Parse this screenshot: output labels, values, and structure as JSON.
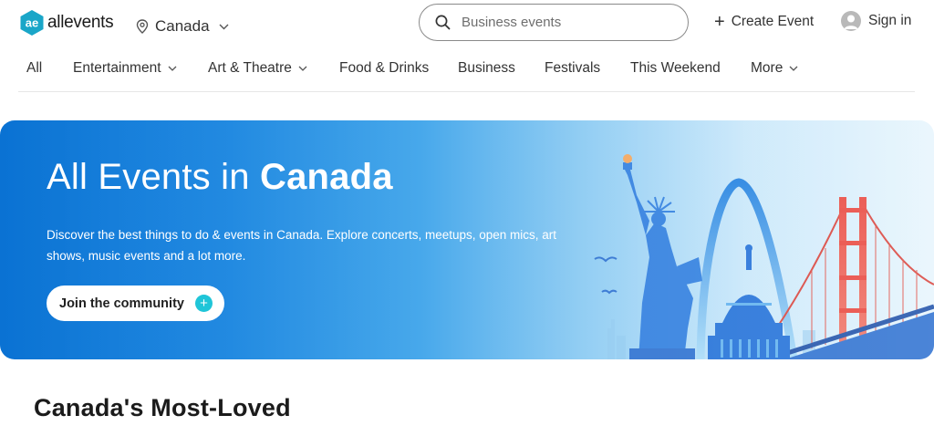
{
  "brand": {
    "name": "allevents",
    "color": "#16a0c4",
    "logo_icon": "ae-logo-icon"
  },
  "header": {
    "location": {
      "icon": "location-pin-icon",
      "label": "Canada"
    },
    "search": {
      "placeholder": "Business events",
      "value": "",
      "icon": "search-icon"
    },
    "create_event": {
      "label": "Create Event",
      "icon": "plus-icon"
    },
    "sign_in": {
      "label": "Sign in",
      "icon": "user-avatar-icon"
    }
  },
  "nav": {
    "items": [
      {
        "label": "All",
        "dropdown": false
      },
      {
        "label": "Entertainment",
        "dropdown": true
      },
      {
        "label": "Art & Theatre",
        "dropdown": true
      },
      {
        "label": "Food & Drinks",
        "dropdown": false
      },
      {
        "label": "Business",
        "dropdown": false
      },
      {
        "label": "Festivals",
        "dropdown": false
      },
      {
        "label": "This Weekend",
        "dropdown": false
      },
      {
        "label": "More",
        "dropdown": true
      }
    ]
  },
  "hero": {
    "title_prefix": "All Events in ",
    "title_bold": "Canada",
    "description": "Discover the best things to do & events in Canada. Explore concerts, meetups, open mics, art shows, music events and a lot more.",
    "cta_label": "Join the community",
    "cta_icon": "plus-circle-icon",
    "gradient_start": "#0a72d3",
    "gradient_end": "#e7f5fd",
    "accent": "#1fc5d8"
  },
  "section": {
    "title": "Canada's Most-Loved"
  }
}
